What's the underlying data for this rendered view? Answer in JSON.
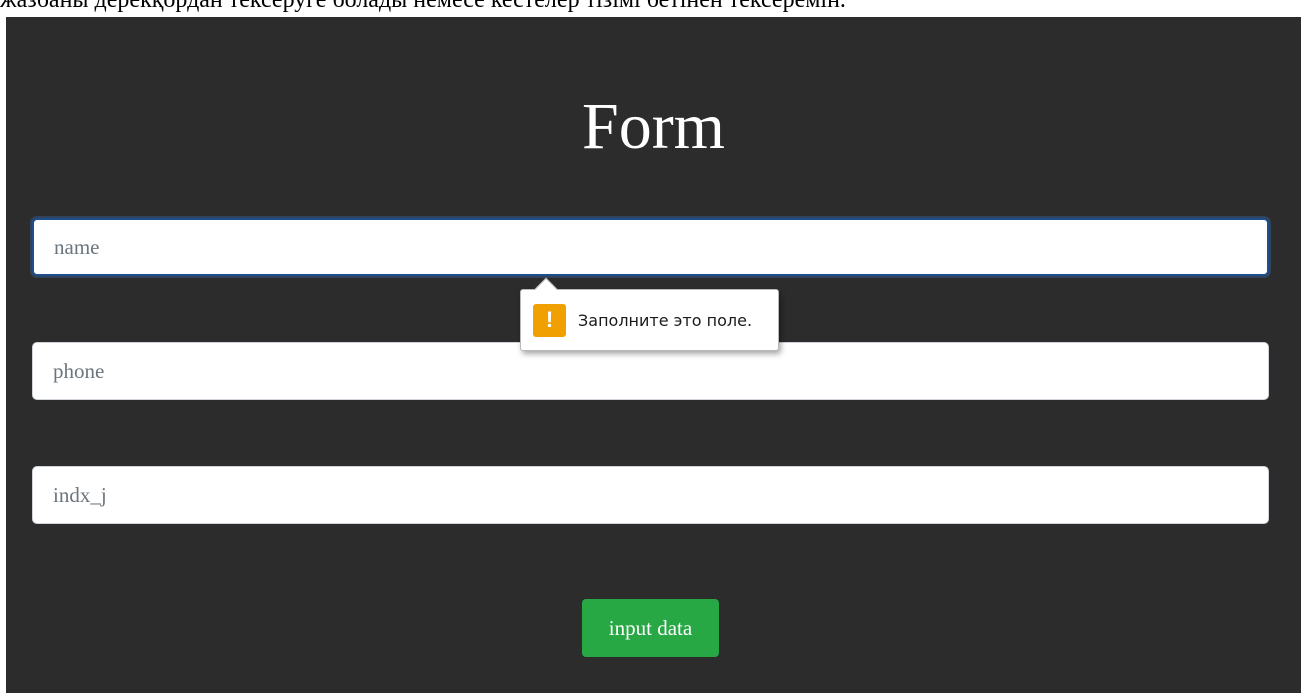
{
  "page": {
    "top_text": "жазбаны дерекқордан тексеруге болады немесе кестелер тізімі бетінен тексеремін."
  },
  "form": {
    "title": "Form",
    "fields": [
      {
        "placeholder": "name",
        "value": ""
      },
      {
        "placeholder": "phone",
        "value": ""
      },
      {
        "placeholder": "indx_j",
        "value": ""
      }
    ],
    "submit_label": "input data"
  },
  "validation_tooltip": {
    "icon": "warning-icon",
    "icon_glyph": "!",
    "message": "Заполните это поле."
  },
  "colors": {
    "background": "#2c2c2c",
    "button": "#28a745",
    "warning": "#f0a000",
    "focus_border": "#1f4e8c"
  }
}
